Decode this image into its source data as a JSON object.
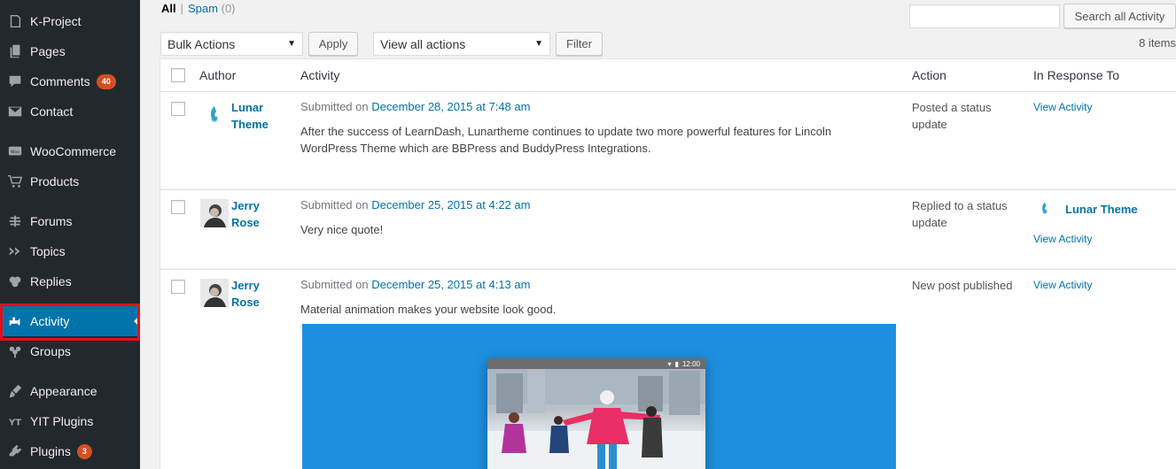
{
  "sidebar": {
    "items": [
      {
        "label": "K-Project",
        "icon": "page-icon"
      },
      {
        "label": "Pages",
        "icon": "pages-icon"
      },
      {
        "label": "Comments",
        "icon": "comment-icon",
        "badge": "40"
      },
      {
        "label": "Contact",
        "icon": "mail-icon"
      },
      {
        "label": "WooCommerce",
        "icon": "woocommerce-icon"
      },
      {
        "label": "Products",
        "icon": "cart-icon"
      },
      {
        "label": "Forums",
        "icon": "forums-icon"
      },
      {
        "label": "Topics",
        "icon": "topics-icon"
      },
      {
        "label": "Replies",
        "icon": "replies-icon"
      },
      {
        "label": "Activity",
        "icon": "activity-icon",
        "current": true
      },
      {
        "label": "Groups",
        "icon": "groups-icon"
      },
      {
        "label": "Appearance",
        "icon": "brush-icon"
      },
      {
        "label": "YIT Plugins",
        "icon": "yit-icon"
      },
      {
        "label": "Plugins",
        "icon": "plugin-icon",
        "badge": "3"
      }
    ]
  },
  "views": {
    "all": "All",
    "separator": "|",
    "spam": "Spam",
    "spam_count": "(0)"
  },
  "search": {
    "placeholder": "",
    "button": "Search all Activity"
  },
  "bulk": {
    "selected": "Bulk Actions",
    "apply": "Apply"
  },
  "filter_select": {
    "selected": "View all actions",
    "button": "Filter"
  },
  "items_count": "8 items",
  "table": {
    "headers": {
      "author": "Author",
      "activity": "Activity",
      "action": "Action",
      "in_response": "In Response To"
    },
    "rows": [
      {
        "author_line1": "Lunar",
        "author_line2": "Theme",
        "submitted_prefix": "Submitted on",
        "date": "December 28, 2015 at 7:48 am",
        "content": "After the success of LearnDash, Lunartheme continues to update two more powerful features for Lincoln WordPress Theme which are BBPress and BuddyPress Integrations.",
        "action": "Posted a status update",
        "response_author": "",
        "response_link": "View Activity"
      },
      {
        "author_line1": "Jerry",
        "author_line2": "Rose",
        "submitted_prefix": "Submitted on",
        "date": "December 25, 2015 at 4:22 am",
        "content": "Very nice quote!",
        "action": "Replied to a status update",
        "response_author": "Lunar Theme",
        "response_link": "View Activity"
      },
      {
        "author_line1": "Jerry",
        "author_line2": "Rose",
        "submitted_prefix": "Submitted on",
        "date": "December 25, 2015 at 4:13 am",
        "content": "Material animation makes your website look good.",
        "action": "New post published",
        "response_author": "",
        "response_link": "View Activity",
        "media_time": "12:00"
      }
    ]
  },
  "colors": {
    "sidebar_bg": "#23282d",
    "accent": "#0073aa",
    "highlight": "#e2101a",
    "badge": "#d54e21",
    "media_bg": "#1e8fde"
  }
}
